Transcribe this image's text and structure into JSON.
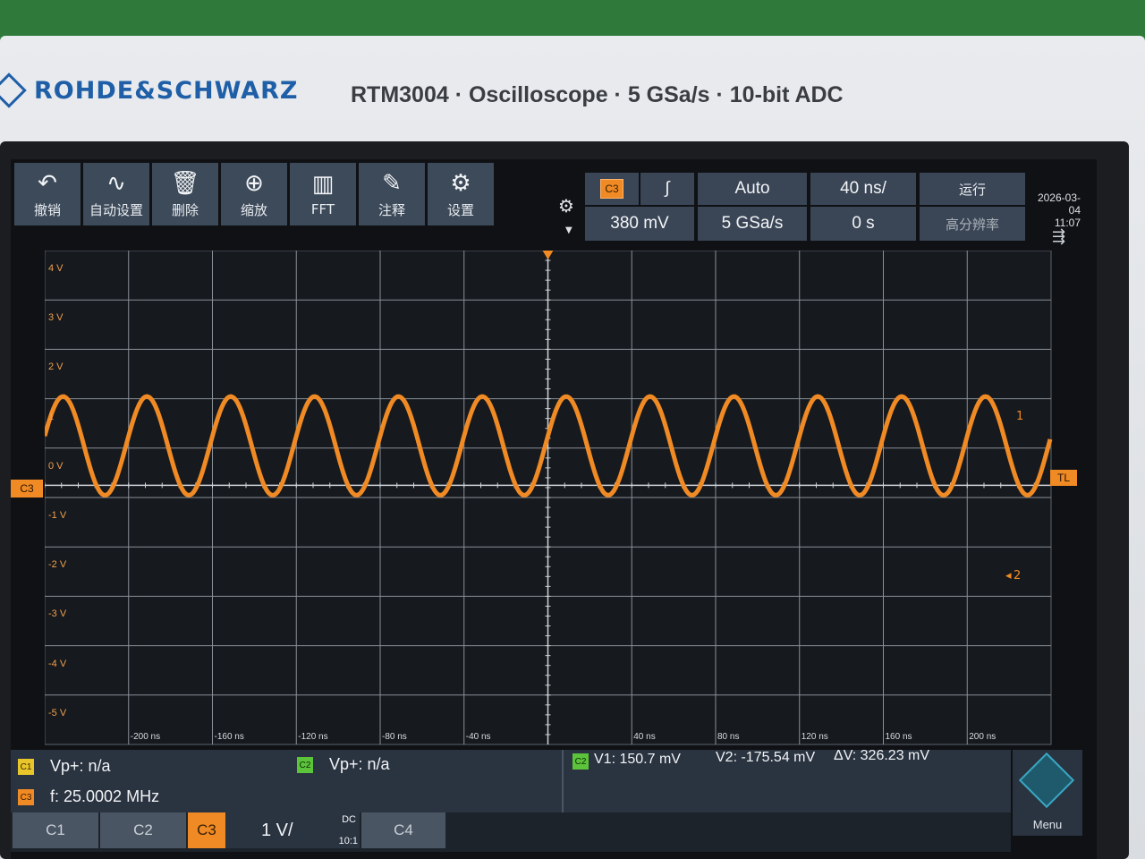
{
  "device": {
    "brand": "ROHDE&SCHWARZ",
    "model_line": "RTM3004 · Oscilloscope · 5 GSa/s · 10-bit ADC"
  },
  "toolbar": [
    {
      "label": "撤销",
      "icon": "undo-icon"
    },
    {
      "label": "自动设置",
      "icon": "autoset-icon"
    },
    {
      "label": "删除",
      "icon": "delete-icon"
    },
    {
      "label": "缩放",
      "icon": "zoom-icon"
    },
    {
      "label": "FFT",
      "icon": "fft-icon"
    },
    {
      "label": "注释",
      "icon": "annotate-icon"
    },
    {
      "label": "设置",
      "icon": "settings-icon"
    }
  ],
  "status": {
    "trigger_channel": "C3",
    "trigger_level": "380 mV",
    "trigger_slope_icon": "rising-edge-icon",
    "trigger_mode": "Auto",
    "sample_rate": "5 GSa/s",
    "timebase": "40 ns/",
    "position": "0 s",
    "run_state": "运行",
    "acq_mode": "高分辨率",
    "date": "2026-03-04",
    "time": "11:07"
  },
  "graph": {
    "y_labels": [
      "4 V",
      "3 V",
      "2 V",
      "1",
      "0 V",
      "-1 V",
      "-2 V",
      "-3 V",
      "-4 V",
      "-5 V"
    ],
    "x_labels": [
      "-200 ns",
      "-160 ns",
      "-120 ns",
      "-80 ns",
      "-40 ns",
      "40 ns",
      "80 ns",
      "120 ns",
      "160 ns",
      "200 ns"
    ],
    "channel_marker": "C3",
    "trigger_level_marker": "TL",
    "cursor1_marker": "1",
    "cursor2_marker": "2",
    "trace_color": "#f08a24",
    "waveform": {
      "frequency_mhz": 25.0002,
      "amplitude_v": 1.0,
      "offset_v": 0.8
    }
  },
  "measurements": {
    "c1_label": "C1",
    "c1_text": "Vp+: n/a",
    "c3_label": "C3",
    "c3_text": "f: 25.0002 MHz",
    "c2_label": "C2",
    "c2_text": "Vp+: n/a",
    "cursor_chip": "C2",
    "v1": "V1: 150.7 mV",
    "v2": "V2: -175.54 mV",
    "dv": "ΔV: 326.23 mV"
  },
  "channels": {
    "c1": "C1",
    "c2": "C2",
    "c3": "C3",
    "c3_scale": "1 V/",
    "c3_coupling": "DC",
    "c3_probe": "10:1",
    "c4": "C4",
    "menu": "Menu"
  }
}
